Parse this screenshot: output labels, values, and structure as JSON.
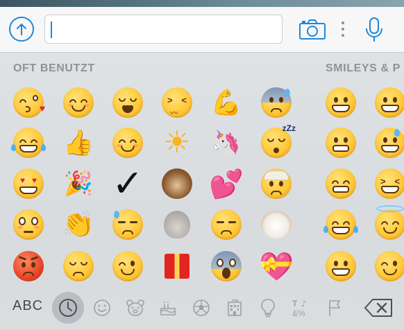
{
  "input_bar": {
    "text_value": "",
    "icons": [
      "upload-arrow-icon",
      "camera-icon",
      "more-vertical-icon",
      "microphone-icon"
    ],
    "accent_color": "#1e88d8"
  },
  "emoji_panel": {
    "sections": [
      {
        "title": "OFT BENUTZT"
      },
      {
        "title": "SMILEYS & P"
      }
    ],
    "frequently_used": [
      [
        "face-blowing-kiss",
        "smiling-face",
        "weary-face",
        "confounded-face",
        "flexed-biceps",
        "anxious-face-with-sweat"
      ],
      [
        "face-with-tears-of-joy",
        "thumbs-up",
        "smiling-face-with-smiling-eyes",
        "sun",
        "unicorn",
        "sleeping-face"
      ],
      [
        "heart-eyes-face",
        "party-popper",
        "check-mark",
        "see-no-evil-monkey",
        "two-hearts",
        "face-with-head-bandage"
      ],
      [
        "flushed-face",
        "clapping-hands",
        "downcast-face-with-sweat",
        "rabbit-face",
        "unamused-face",
        "dog-face"
      ],
      [
        "pouting-face",
        "pensive-face",
        "winking-face",
        "wrapped-gift",
        "face-screaming-in-fear",
        "heart-with-ribbon"
      ]
    ],
    "smileys_and_people": [
      [
        "grinning-face",
        "grinning-face-partial"
      ],
      [
        "grimacing-face",
        "grinning-sweat-partial"
      ],
      [
        "grimacing-face",
        "squinting-laughing-partial"
      ],
      [
        "face-with-tears-of-joy",
        "smiling-face-with-halo-partial"
      ],
      [
        "grinning-face",
        "winking-face-partial"
      ]
    ]
  },
  "bottom_bar": {
    "abc_label": "ABC",
    "categories": [
      "recent-clock-icon",
      "smiley-icon",
      "bear-icon",
      "cake-icon",
      "soccer-ball-icon",
      "building-icon",
      "light-bulb-icon",
      "symbols-icon",
      "flag-icon"
    ],
    "selected_category": "recent-clock-icon",
    "delete_icon": "backspace-icon"
  }
}
